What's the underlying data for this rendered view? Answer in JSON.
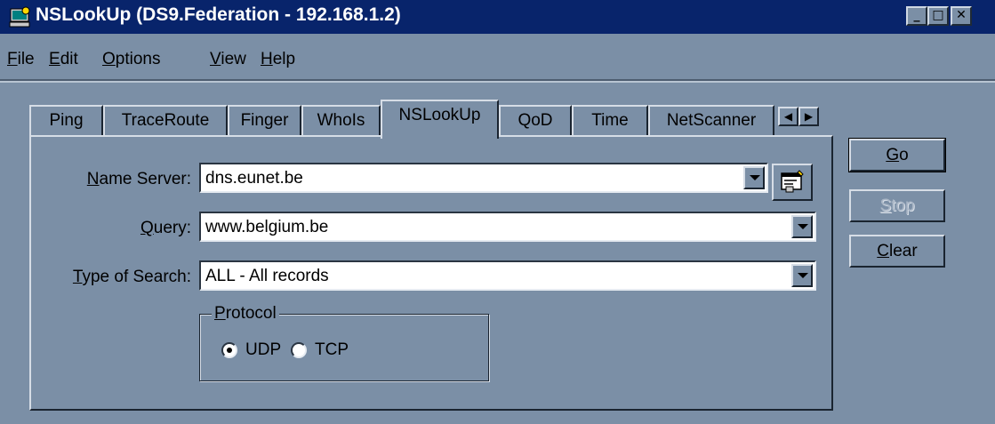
{
  "window": {
    "title": "NSLookUp (DS9.Federation - 192.168.1.2)",
    "controls": {
      "minimize": "_",
      "maximize": "□",
      "close": "✕"
    },
    "app_icon": "network-tool-icon"
  },
  "menu": [
    {
      "hot": "F",
      "rest": "ile"
    },
    {
      "hot": "E",
      "rest": "dit"
    },
    {
      "hot": "O",
      "rest": "ptions"
    },
    {
      "hot": "V",
      "rest": "iew"
    },
    {
      "hot": "H",
      "rest": "elp"
    }
  ],
  "tabs": [
    "Ping",
    "TraceRoute",
    "Finger",
    "WhoIs",
    "NSLookUp",
    "QoD",
    "Time",
    "NetScanner"
  ],
  "active_tab": "NSLookUp",
  "form": {
    "name_server": {
      "hot": "N",
      "rest": "ame Server:",
      "value": "dns.eunet.be"
    },
    "query": {
      "pre": "",
      "hot": "Q",
      "rest": "uery:",
      "value": "www.belgium.be"
    },
    "type_of_search": {
      "hot": "T",
      "rest": "ype of Search:",
      "value": "ALL - All records"
    }
  },
  "protocol": {
    "legend_hot": "P",
    "legend_rest": "rotocol",
    "options": [
      {
        "label": "UDP",
        "selected": true
      },
      {
        "label": "TCP",
        "selected": false
      }
    ]
  },
  "buttons": {
    "go": {
      "hot": "G",
      "rest": "o"
    },
    "stop": {
      "hot": "S",
      "rest": "top",
      "disabled": true
    },
    "clear": {
      "hot": "C",
      "rest": "lear"
    }
  },
  "colors": {
    "face": "#7b8fa6",
    "titlebar": "#08246b",
    "field": "#ffffff"
  }
}
